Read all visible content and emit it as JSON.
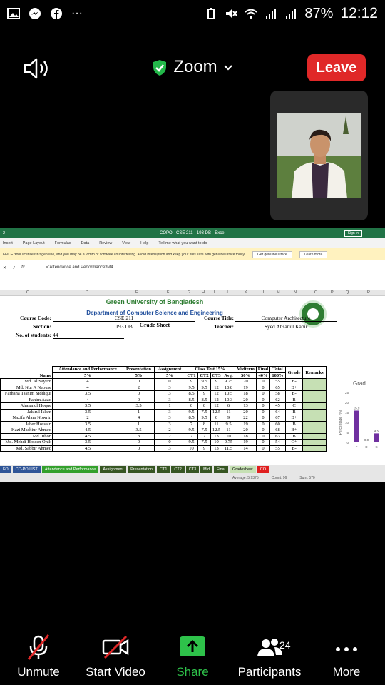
{
  "status_bar": {
    "battery": "87%",
    "time": "12:12"
  },
  "meeting": {
    "app_title": "Zoom",
    "leave_label": "Leave"
  },
  "excel": {
    "window_title": "COPO - CSE 211 - 193 DB  -  Excel",
    "signin_label": "Sign in",
    "ribbon": [
      "Insert",
      "Page Layout",
      "Formulas",
      "Data",
      "Review",
      "View",
      "Help",
      "Tell me what you want to do"
    ],
    "warning": "FFICE  Your license isn't genuine, and you may be a victim of software counterfeiting. Avoid interruption and keep your files safe with genuine Office today.",
    "warning_btn1": "Get genuine Office",
    "warning_btn2": "Learn more",
    "formula": "='Attendance and Performance'!M4",
    "columns": [
      "C",
      "D",
      "E",
      "F",
      "G",
      "H",
      "I",
      "J",
      "K",
      "L",
      "M",
      "N",
      "O",
      "P",
      "Q",
      "R"
    ],
    "university": "Green University of Bangladesh",
    "department": "Department of Computer Science and Engineering",
    "sheet_title": "Grade Sheet",
    "course_code_label": "Course Code:",
    "course_code": "CSE 211",
    "section_label": "Section:",
    "section": "193 DB",
    "students_label": "No. of students:",
    "students": "44",
    "course_title_label": "Course Title:",
    "course_title": "Computer Architecture",
    "teacher_label": "Teacher:",
    "teacher": "Syed Ahsanul Kabir",
    "headers": {
      "name": "Name",
      "attendance": "Attendance and Performance",
      "attendance_pct": "5%",
      "presentation": "Presentation",
      "presentation_pct": "5%",
      "assignment": "Assignment",
      "assignment_pct": "5%",
      "class_test": "Class Test 15%",
      "ct1": "CT1",
      "ct2": "CT2",
      "ct3": "CT3",
      "avg": "Avg.",
      "midterm": "Midterm",
      "midterm_pct": "30%",
      "final": "Final",
      "final_pct": "40%",
      "total": "Total",
      "total_pct": "100%",
      "grade": "Grade",
      "remarks": "Remarks"
    },
    "rows": [
      {
        "id": "0",
        "name": "Md. Al Sayem",
        "att": "4",
        "pres": "0",
        "asg": "0",
        "ct1": "9",
        "ct2": "9.5",
        "ct3": "9",
        "avg": "9.25",
        "mid": "20",
        "fin": "0",
        "total": "55",
        "grade": "B-"
      },
      {
        "id": "3",
        "name": "Md. Nur A Neouse",
        "att": "4",
        "pres": "2",
        "asg": "3",
        "ct1": "9.5",
        "ct2": "9.5",
        "ct3": "12",
        "avg": "10.8",
        "mid": "19",
        "fin": "0",
        "total": "65",
        "grade": "B+"
      },
      {
        "id": "0",
        "name": "Farhana Tasnim Siddiqui",
        "att": "3.5",
        "pres": "0",
        "asg": "3",
        "ct1": "8.5",
        "ct2": "9",
        "ct3": "12",
        "avg": "10.5",
        "mid": "18",
        "fin": "0",
        "total": "58",
        "grade": "B-"
      },
      {
        "id": "7",
        "name": "Fahim Azad",
        "att": "4",
        "pres": "0",
        "asg": "3",
        "ct1": "8.5",
        "ct2": "8.5",
        "ct3": "12",
        "avg": "10.3",
        "mid": "20",
        "fin": "0",
        "total": "62",
        "grade": "B"
      },
      {
        "id": "8",
        "name": "Ahasanul Hoque",
        "att": "3.5",
        "pres": "3.5",
        "asg": "1",
        "ct1": "0",
        "ct2": "0",
        "ct3": "12",
        "avg": "6",
        "mid": "13",
        "fin": "0",
        "total": "45",
        "grade": "C"
      },
      {
        "id": "1",
        "name": "Jakirul Islam",
        "att": "3.5",
        "pres": "1",
        "asg": "3",
        "ct1": "9.5",
        "ct2": "7.5",
        "ct3": "12.5",
        "avg": "11",
        "mid": "20",
        "fin": "0",
        "total": "64",
        "grade": "B"
      },
      {
        "id": "3",
        "name": "Nazifa Alam Nowrin",
        "att": "2",
        "pres": "4",
        "asg": "3",
        "ct1": "8.5",
        "ct2": "9.5",
        "ct3": "0",
        "avg": "9",
        "mid": "22",
        "fin": "0",
        "total": "67",
        "grade": "B+"
      },
      {
        "id": "0",
        "name": "Jaber Hossain",
        "att": "3.5",
        "pres": "1",
        "asg": "3",
        "ct1": "7",
        "ct2": "8",
        "ct3": "11",
        "avg": "9.5",
        "mid": "19",
        "fin": "0",
        "total": "60",
        "grade": "B"
      },
      {
        "id": "5",
        "name": "Kazi Mashiur Ahmed",
        "att": "4.5",
        "pres": "3.5",
        "asg": "2",
        "ct1": "9.5",
        "ct2": "7.5",
        "ct3": "12.5",
        "avg": "11",
        "mid": "20",
        "fin": "0",
        "total": "68",
        "grade": "B+"
      },
      {
        "id": "3",
        "name": "Md. Jihon",
        "att": "4.5",
        "pres": "3",
        "asg": "2",
        "ct1": "7",
        "ct2": "7",
        "ct3": "13",
        "avg": "10",
        "mid": "18",
        "fin": "0",
        "total": "63",
        "grade": "B"
      },
      {
        "id": "4",
        "name": "Md. Mehdi Hossen Onik",
        "att": "3.5",
        "pres": "0",
        "asg": "0",
        "ct1": "9.5",
        "ct2": "7.5",
        "ct3": "10",
        "avg": "9.75",
        "mid": "19",
        "fin": "0",
        "total": "54",
        "grade": "C+"
      },
      {
        "id": "5",
        "name": "Md. Sabbir Ahmed",
        "att": "4.5",
        "pres": "0",
        "asg": "3",
        "ct1": "10",
        "ct2": "9",
        "ct3": "13",
        "avg": "11.5",
        "mid": "14",
        "fin": "0",
        "total": "55",
        "grade": "B-"
      }
    ],
    "chart_title": "Grad",
    "chart_ylabel": "Percentage (%)",
    "chart_yticks": [
      "25",
      "20",
      "15",
      "10",
      "5",
      "0"
    ],
    "chart_bars": [
      {
        "label": "F",
        "value": 15.9,
        "text": "15.9"
      },
      {
        "label": "D",
        "value": 0.0,
        "text": "0.0"
      },
      {
        "label": "C",
        "value": 4.5,
        "text": "4.5"
      }
    ],
    "sheet_tabs": [
      {
        "label": "FO",
        "color": "#2f5597"
      },
      {
        "label": "CO-PO LIST",
        "color": "#2f5597"
      },
      {
        "label": "Attendance and Performance",
        "color": "#33a02c"
      },
      {
        "label": "Assignment",
        "color": "#375623"
      },
      {
        "label": "Presentation",
        "color": "#375623"
      },
      {
        "label": "CT1",
        "color": "#375623"
      },
      {
        "label": "CT2",
        "color": "#375623"
      },
      {
        "label": "CT3",
        "color": "#375623"
      },
      {
        "label": "Mid",
        "color": "#375623"
      },
      {
        "label": "Final",
        "color": "#375623"
      },
      {
        "label": "Gradesheet",
        "color": "#c6e0b4"
      },
      {
        "label": "CO",
        "color": "#e02020"
      }
    ],
    "status_average": "Average: 5.9375",
    "status_count": "Count: 96",
    "status_sum": "Sum: 570"
  },
  "controls": {
    "unmute": "Unmute",
    "start_video": "Start Video",
    "share": "Share",
    "participants": "Participants",
    "participants_count": "24",
    "more": "More"
  },
  "colors": {
    "leave": "#e02828",
    "share": "#2ec24a",
    "excel_green": "#217346",
    "grade_fill": "#c6e0b4",
    "chart_bar": "#7030a0"
  }
}
